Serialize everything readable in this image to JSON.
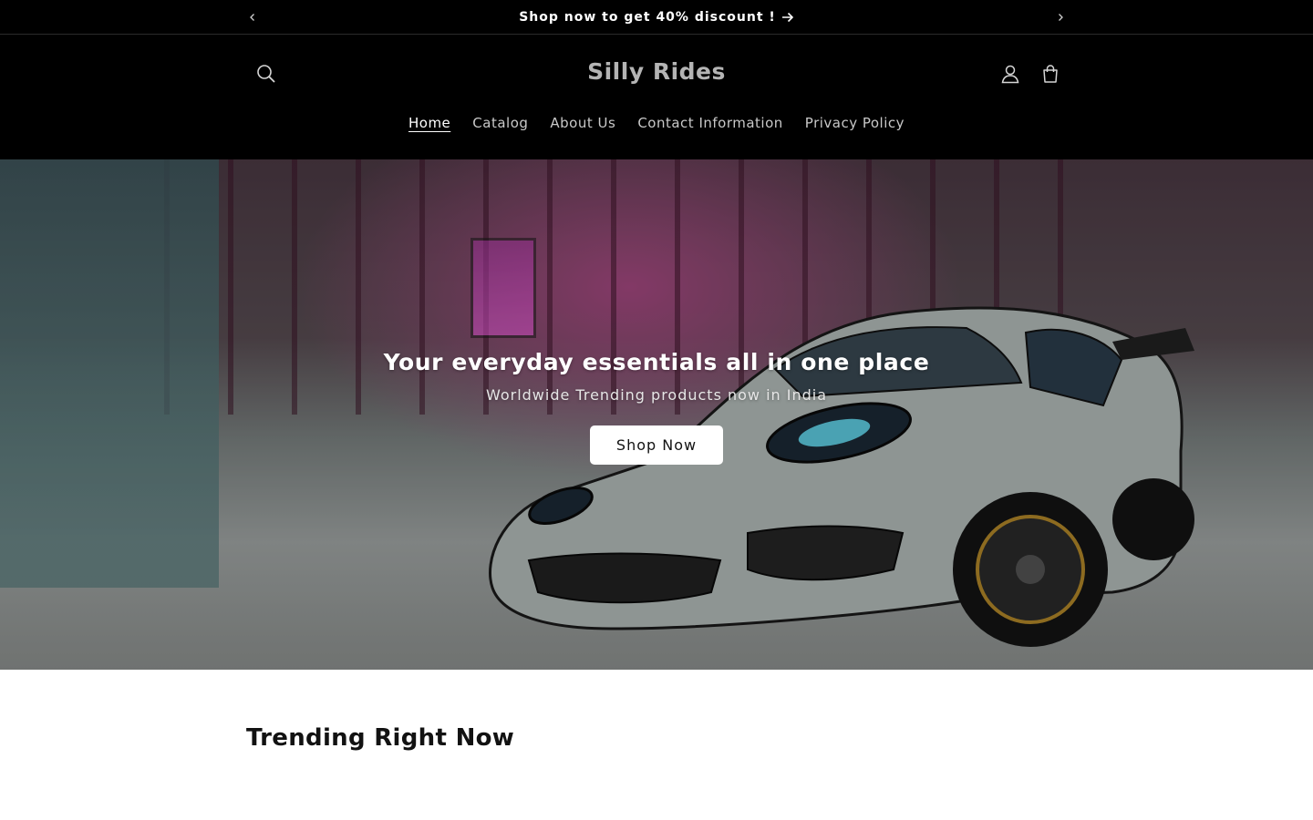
{
  "announcement": {
    "text": "Shop now to get 40% discount !",
    "prev_icon": "chevron-left-icon",
    "next_icon": "chevron-right-icon",
    "arrow_icon": "arrow-right-icon"
  },
  "header": {
    "logo": "Silly Rides",
    "search_icon": "search-icon",
    "account_icon": "account-icon",
    "cart_icon": "cart-icon"
  },
  "nav": {
    "items": [
      {
        "label": "Home",
        "active": true
      },
      {
        "label": "Catalog",
        "active": false
      },
      {
        "label": "About Us",
        "active": false
      },
      {
        "label": "Contact Information",
        "active": false
      },
      {
        "label": "Privacy Policy",
        "active": false
      }
    ]
  },
  "hero": {
    "heading": "Your everyday essentials all in one place",
    "subheading": "Worldwide Trending products now in India",
    "button_label": "Shop Now"
  },
  "trending": {
    "heading": "Trending Right Now"
  },
  "colors": {
    "header_bg": "#000000",
    "logo": "#b4b4b4",
    "nav_text": "#c9c9c9",
    "button_bg": "#ffffff"
  }
}
